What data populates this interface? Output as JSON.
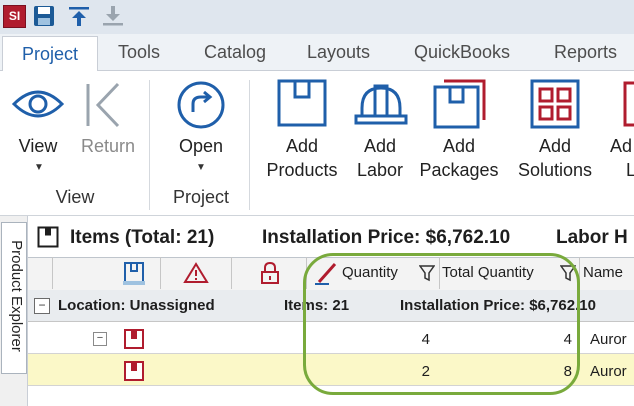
{
  "app": {
    "logo_text": "SI"
  },
  "tabs": [
    {
      "label": "Project",
      "active": true
    },
    {
      "label": "Tools"
    },
    {
      "label": "Catalog"
    },
    {
      "label": "Layouts"
    },
    {
      "label": "QuickBooks"
    },
    {
      "label": "Reports"
    }
  ],
  "ribbon": {
    "view_label": "View",
    "return_label": "Return",
    "open_label": "Open",
    "group_view": "View",
    "group_project": "Project",
    "add_products": [
      "Add",
      "Products"
    ],
    "add_labor": [
      "Add",
      "Labor"
    ],
    "add_packages": [
      "Add",
      "Packages"
    ],
    "add_solutions": [
      "Add",
      "Solutions"
    ],
    "add_cut": [
      "Ad",
      "L"
    ]
  },
  "side_panel": {
    "label": "Product Explorer"
  },
  "items_header": {
    "title": "Items (Total: 21)",
    "installation_price": "Installation Price: $6,762.10",
    "labor_cut": "Labor H"
  },
  "grid": {
    "columns": {
      "quantity": "Quantity",
      "total_quantity": "Total Quantity",
      "name": "Name"
    },
    "group": {
      "location": "Location: Unassigned",
      "items": "Items: 21",
      "installation_price": "Installation Price: $6,762.10"
    },
    "rows": [
      {
        "expander": "−",
        "quantity": "4",
        "total_quantity": "4",
        "name": "Auror"
      },
      {
        "expander": "",
        "quantity": "2",
        "total_quantity": "8",
        "name": "Auror"
      }
    ]
  },
  "colors": {
    "accent_blue": "#1f5faa",
    "brand_red": "#b01c2e",
    "highlight_green": "#79aa3c",
    "selected_row": "#fbf8c8"
  }
}
